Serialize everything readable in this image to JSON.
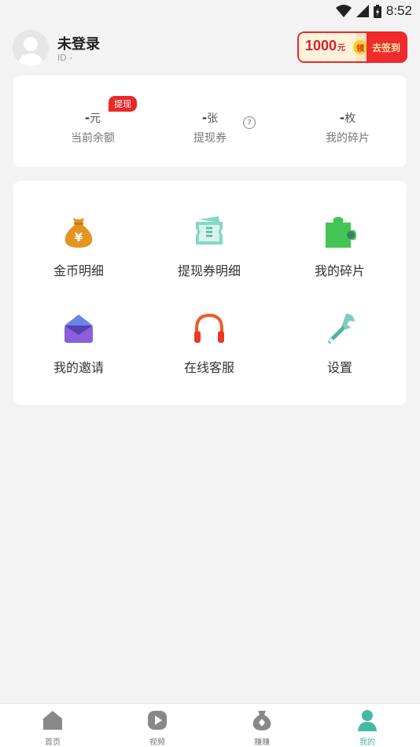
{
  "status_bar": {
    "time": "8:52"
  },
  "profile": {
    "name": "未登录",
    "id_text": "ID -",
    "checkin": {
      "amount": "1000",
      "unit": "元",
      "coin_label": "领",
      "action": "去签到"
    }
  },
  "stats": {
    "withdraw_badge": "提现",
    "items": [
      {
        "value": "-",
        "unit": "元",
        "label": "当前余额"
      },
      {
        "value": "-",
        "unit": "张",
        "label": "提现券"
      },
      {
        "value": "-",
        "unit": "枚",
        "label": "我的碎片"
      }
    ],
    "help_icon": "question-circle-icon",
    "help_glyph": "?"
  },
  "menu": {
    "items": [
      {
        "label": "金币明细",
        "icon": "money-bag-icon"
      },
      {
        "label": "提现券明细",
        "icon": "ticket-icon"
      },
      {
        "label": "我的碎片",
        "icon": "puzzle-icon"
      },
      {
        "label": "我的邀请",
        "icon": "envelope-icon"
      },
      {
        "label": "在线客服",
        "icon": "headphones-icon"
      },
      {
        "label": "设置",
        "icon": "wrench-icon"
      }
    ]
  },
  "tabbar": {
    "items": [
      {
        "label": "首页",
        "icon": "home-icon"
      },
      {
        "label": "视频",
        "icon": "play-icon"
      },
      {
        "label": "赚赚",
        "icon": "money-pouch-icon"
      },
      {
        "label": "我的",
        "icon": "person-icon",
        "active": true
      }
    ]
  },
  "colors": {
    "accent": "#45b8a6",
    "red": "#e8292b",
    "background": "#f3f3f3"
  }
}
